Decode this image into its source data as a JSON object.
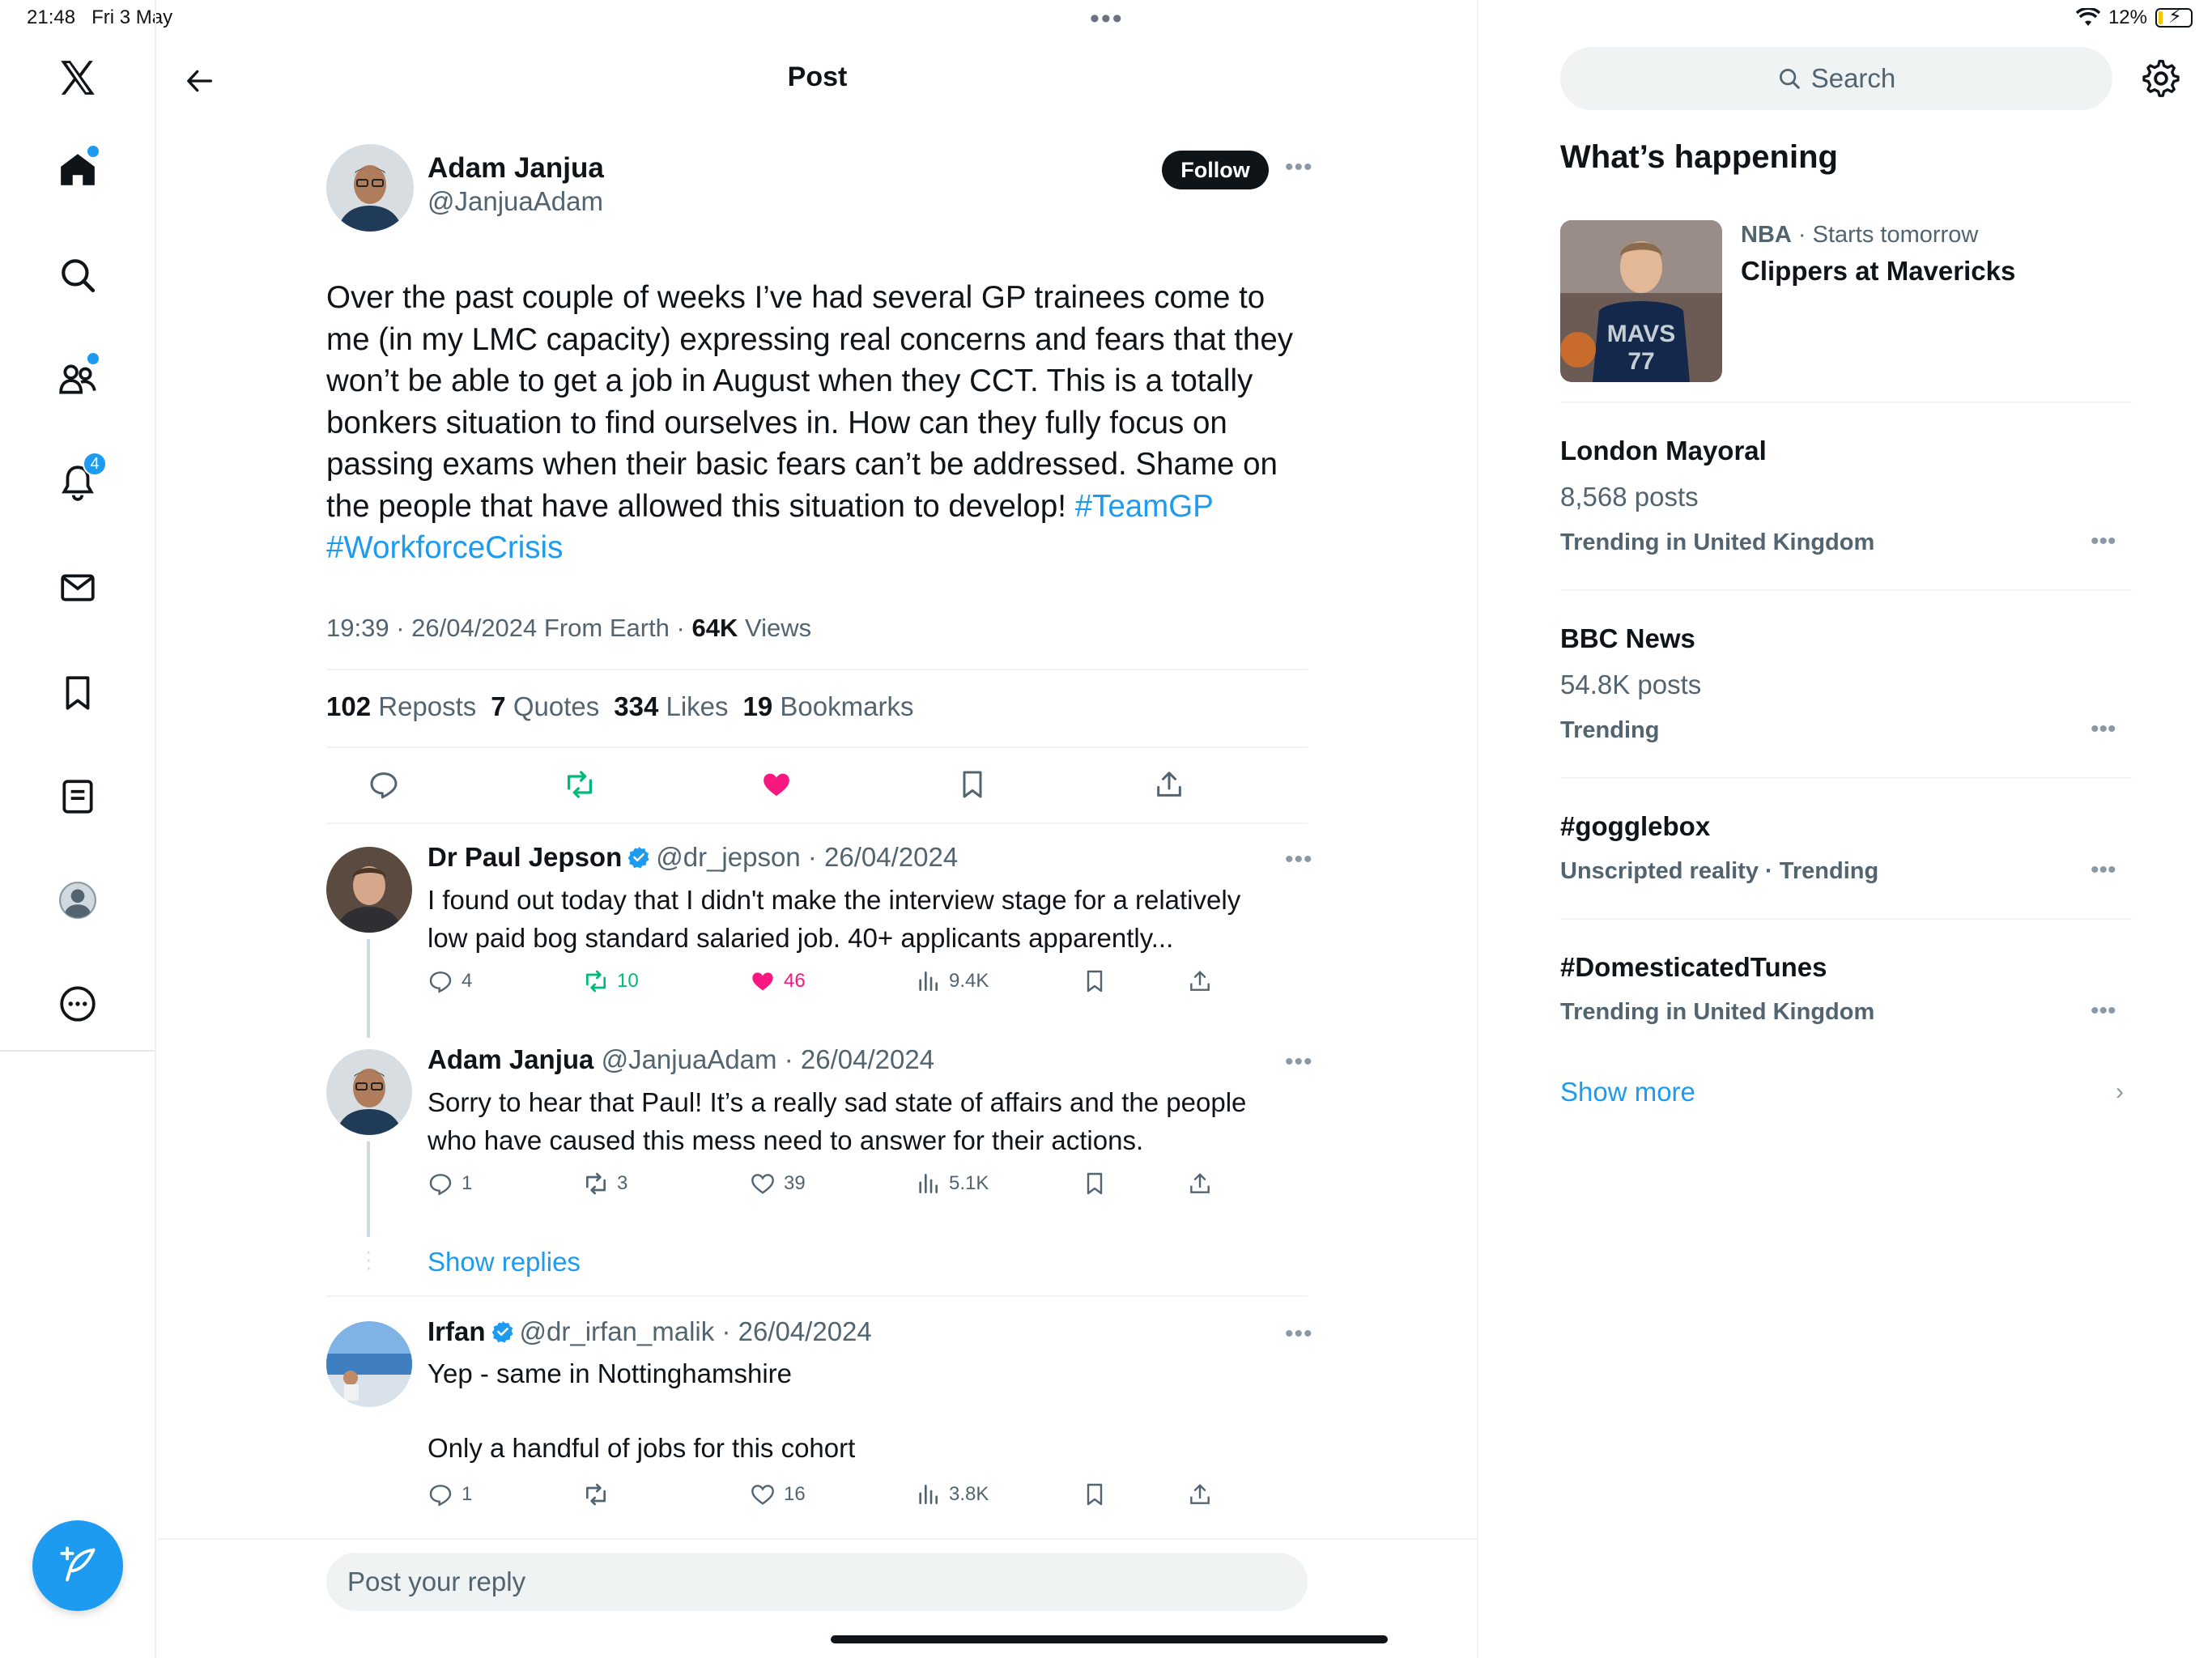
{
  "status_bar": {
    "time": "21:48",
    "date": "Fri 3 May",
    "battery": "12%",
    "battery_level": 0.12
  },
  "nav": {
    "items": [
      "x-logo",
      "home",
      "search",
      "communities",
      "notifications",
      "messages",
      "bookmarks",
      "lists",
      "profile",
      "more"
    ],
    "notifications_badge": "4"
  },
  "header": {
    "title": "Post"
  },
  "post": {
    "author_name": "Adam Janjua",
    "author_handle": "@JanjuaAdam",
    "follow_label": "Follow",
    "text": "Over the past couple of weeks I’ve had several GP trainees come to me (in my LMC capacity) expressing real concerns and fears that they won’t be able to get a job in August when they CCT. This is a totally bonkers situation to find ourselves in. How can they fully focus on passing exams when their basic fears can’t be addressed. Shame on the people that have allowed this situation to develop!",
    "hashtag1": "#TeamGP",
    "hashtag2": "#WorkforceCrisis",
    "timestamp": "19:39 · 26/04/2024 From Earth ·",
    "views_count": "64K",
    "views_label": "Views",
    "stats": {
      "reposts_count": "102",
      "reposts_label": "Reposts",
      "quotes_count": "7",
      "quotes_label": "Quotes",
      "likes_count": "334",
      "likes_label": "Likes",
      "bookmarks_count": "19",
      "bookmarks_label": "Bookmarks"
    }
  },
  "replies": [
    {
      "name": "Dr Paul Jepson",
      "handle": "@dr_jepson",
      "date": "· 26/04/2024",
      "line1": "I found out today that I didn't make the interview stage for a relatively",
      "line2": "low paid bog standard salaried job. 40+ applicants apparently...",
      "replies": "4",
      "reposts": "10",
      "likes": "46",
      "views": "9.4K"
    },
    {
      "name": "Adam Janjua",
      "handle": "@JanjuaAdam",
      "date": "· 26/04/2024",
      "line1": "Sorry to hear that Paul! It’s a really sad state of affairs and the people",
      "line2": "who have caused this mess need to answer for their actions.",
      "replies": "1",
      "reposts": "3",
      "likes": "39",
      "views": "5.1K"
    },
    {
      "name": "Irfan",
      "handle": "@dr_irfan_malik",
      "date": "· 26/04/2024",
      "line1": "Yep - same in Nottinghamshire",
      "line2": "Only a handful of jobs for this cohort",
      "replies": "1",
      "reposts": "",
      "likes": "16",
      "views": "3.8K"
    }
  ],
  "show_replies": "Show replies",
  "reply_placeholder": "Post your reply",
  "sidebar": {
    "search_placeholder": "Search",
    "heading": "What’s happening",
    "featured": {
      "category": "NBA",
      "subtitle": "· Starts tomorrow",
      "title": "Clippers at Mavericks"
    },
    "trends": [
      {
        "title": "London Mayoral",
        "posts": "8,568 posts",
        "context": "Trending in United Kingdom"
      },
      {
        "title": "BBC News",
        "posts": "54.8K posts",
        "context": "Trending"
      },
      {
        "title": "#gogglebox",
        "posts": "",
        "context": "Unscripted reality · Trending"
      },
      {
        "title": "#DomesticatedTunes",
        "posts": "",
        "context": "Trending in United Kingdom"
      }
    ],
    "show_more": "Show more"
  },
  "colors": {
    "accent": "#1d9bf0",
    "like": "#f91880",
    "repost": "#00ba7c",
    "text": "#0f1419",
    "muted": "#536471"
  }
}
